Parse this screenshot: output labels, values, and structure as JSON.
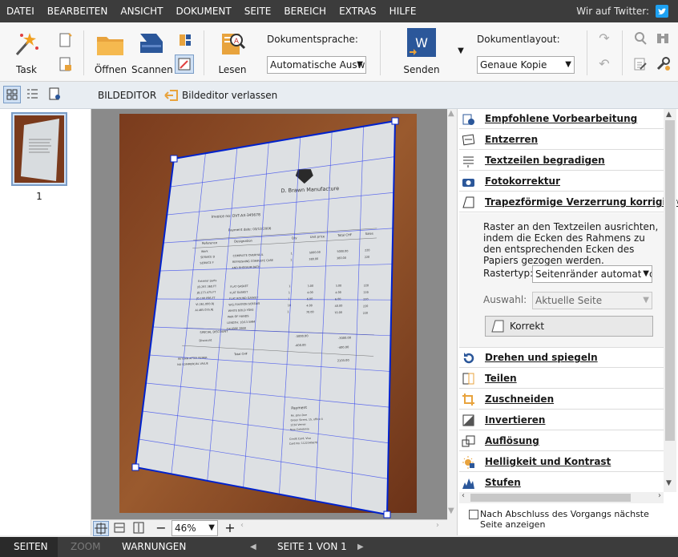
{
  "menu": {
    "items": [
      "DATEI",
      "BEARBEITEN",
      "ANSICHT",
      "DOKUMENT",
      "SEITE",
      "BEREICH",
      "EXTRAS",
      "HILFE"
    ],
    "twitter_label": "Wir auf Twitter:"
  },
  "ribbon": {
    "task_label": "Task",
    "open_label": "Öffnen",
    "scan_label": "Scannen",
    "read_label": "Lesen",
    "doc_language_label": "Dokumentsprache:",
    "doc_language_value": "Automatische Ausw",
    "send_label": "Senden",
    "doc_layout_label": "Dokumentlayout:",
    "doc_layout_value": "Genaue Kopie"
  },
  "toolbar": {
    "editor_title": "BILDEDITOR",
    "exit_label": "Bildeditor verlassen"
  },
  "thumbnails": {
    "page_number": "1"
  },
  "image_editor": {
    "document": {
      "company": "D. Brawn Manufacture",
      "invoice_no": "Invoice no: DVT-AX-345678",
      "payment_date": "Payment date: 03/13/2006",
      "table_headers": [
        "Reference",
        "Designation",
        "Qty",
        "Unit price",
        "Total CHF",
        "Sales"
      ],
      "rows": [
        [
          "Work",
          "",
          "",
          "",
          "",
          ""
        ],
        [
          "SERVICE D",
          "COMPLETE OVERHAUL",
          "1",
          "5000.00",
          "5000.00",
          "220"
        ],
        [
          "SERVICE F",
          "REFRESHING COMPLETE CASE",
          "1",
          "380.00",
          "380.00",
          "220"
        ],
        [
          "",
          "AND RHODIUM BATH",
          "",
          "",
          "",
          ""
        ],
        [
          "Exterior parts",
          "",
          "",
          "",
          "",
          ""
        ],
        [
          "JO.297.360.FT",
          "FLAT GASKET",
          "1",
          "3.00",
          "3.00",
          "220"
        ],
        [
          "JO.273.475.FT",
          "FLAT GASKET",
          "1",
          "4.00",
          "4.00",
          "220"
        ],
        [
          "JO.190.096.FT",
          "FLAT ROUND GASKET",
          "1",
          "6.00",
          "6.00",
          "220"
        ],
        [
          "VI.261.000.RJ",
          "W.G.FIXATION SCREWS",
          "10",
          "4.00",
          "40.00",
          "220"
        ],
        [
          "AI.465.035.RJ",
          "WHITE GOLD YOKE",
          "1",
          "70.00",
          "70.00",
          "220"
        ],
        [
          "",
          "PAIR OF HANDS",
          "",
          "",
          "",
          ""
        ],
        [
          "",
          "LENGTH: 10/13.5MM",
          "",
          "",
          "",
          ""
        ],
        [
          "",
          "CALIBRE 2868",
          "",
          "",
          "",
          ""
        ]
      ],
      "special_discount": "SPECIAL DISCOUNT",
      "special_discount_value": "-3000.00",
      "special_discount_total": "-3000.00",
      "discount": "Discount",
      "discount_value": "-400.00",
      "discount_total": "-400.00",
      "total_label": "Total CHF",
      "total_value": "2103.00",
      "notes": [
        "RETURN AFTER REPAIR",
        "NO COMMERCIAL VALUE"
      ],
      "payment_title": "Payment",
      "payment_lines": [
        "Mr. John Doe",
        "Green Street, 15, office 4",
        "1234 Verner",
        "New Caledonia",
        "",
        "Credit Card, Visa",
        "Card No: 1122345678"
      ]
    }
  },
  "zoombar": {
    "zoom_value": "46%"
  },
  "right_panel": {
    "sections_top": [
      {
        "label": "Empfohlene Vorbearbeitung",
        "icon": "gear-magic-icon"
      },
      {
        "label": "Entzerren",
        "icon": "deskew-icon"
      },
      {
        "label": "Textzeilen begradigen",
        "icon": "straighten-lines-icon"
      },
      {
        "label": "Fotokorrektur",
        "icon": "camera-icon"
      },
      {
        "label": "Trapezförmige Verzerrung korrigieren",
        "icon": "trapezoid-icon"
      }
    ],
    "trapezoid": {
      "description": "Raster an den Textzeilen ausrichten, indem die Ecken des Rahmens zu den entsprechenden Ecken des Papiers gezogen werden.",
      "grid_type_label": "Rastertyp:",
      "grid_type_value": "Seitenränder automatisch e",
      "selection_label": "Auswahl:",
      "selection_value": "Aktuelle Seite",
      "correct_button": "Korrekt"
    },
    "sections_bottom": [
      {
        "label": "Drehen und spiegeln",
        "icon": "rotate-icon"
      },
      {
        "label": "Teilen",
        "icon": "split-icon"
      },
      {
        "label": "Zuschneiden",
        "icon": "crop-icon"
      },
      {
        "label": "Invertieren",
        "icon": "invert-icon"
      },
      {
        "label": "Auflösung",
        "icon": "resolution-icon"
      },
      {
        "label": "Helligkeit und Kontrast",
        "icon": "brightness-icon"
      },
      {
        "label": "Stufen",
        "icon": "levels-icon"
      }
    ],
    "next_page_checkbox": "Nach Abschluss des Vorgangs nächste Seite anzeigen"
  },
  "statusbar": {
    "pages_tab": "SEITEN",
    "zoom_tab": "ZOOM",
    "warnings_tab": "WARNUNGEN",
    "page_indicator": "SEITE 1 VON 1"
  },
  "colors": {
    "menubar": "#3c3c3c",
    "accent_blue": "#0033cc",
    "ribbon_blue": "#2b579a",
    "orange": "#e8a33d"
  }
}
